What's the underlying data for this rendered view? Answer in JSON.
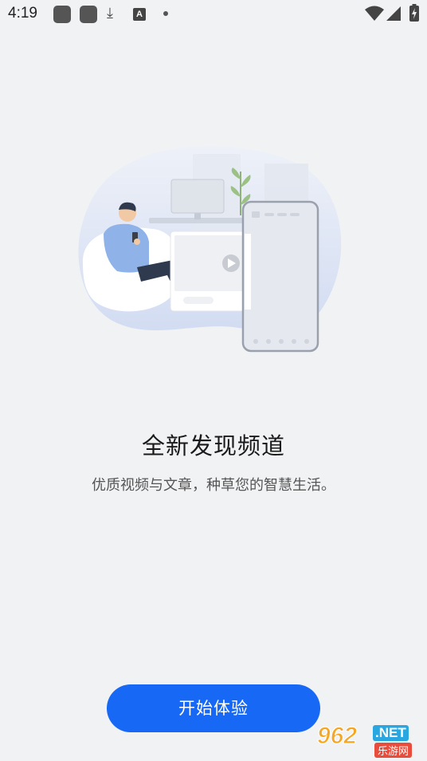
{
  "status_bar": {
    "time": "4:19",
    "icons": [
      "notification-square-icon",
      "notification-square-icon",
      "download-icon",
      "font-a-icon",
      "dot-icon",
      "wifi-icon",
      "signal-icon",
      "battery-charging-icon"
    ],
    "a_badge": "A"
  },
  "main": {
    "title": "全新发现频道",
    "subtitle": "优质视频与文章，种草您的智慧生活。",
    "start_button": "开始体验"
  },
  "watermark": {
    "number": "962",
    "domain": ".NET",
    "site": "乐游网"
  },
  "colors": {
    "background": "#f1f2f4",
    "accent": "#1768f4",
    "title_text": "#1a1a1a",
    "subtitle_text": "#555555"
  }
}
